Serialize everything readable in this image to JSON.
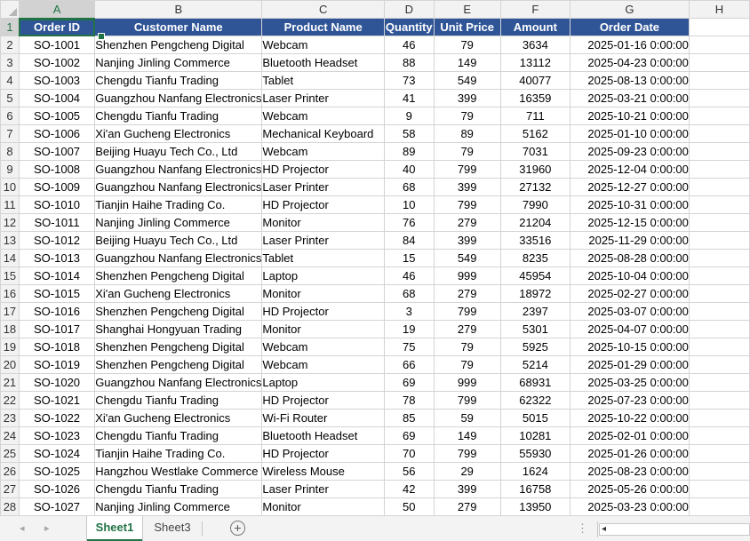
{
  "sheet": {
    "columns": [
      "A",
      "B",
      "C",
      "D",
      "E",
      "F",
      "G",
      "H"
    ],
    "active_column": "A",
    "active_row": "1",
    "headers": [
      "Order ID",
      "Customer Name",
      "Product Name",
      "Quantity",
      "Unit Price",
      "Amount",
      "Order Date"
    ],
    "rows": [
      [
        "SO-1001",
        "Shenzhen Pengcheng Digital",
        "Webcam",
        "46",
        "79",
        "3634",
        "2025-01-16 0:00:00"
      ],
      [
        "SO-1002",
        "Nanjing Jinling Commerce",
        "Bluetooth Headset",
        "88",
        "149",
        "13112",
        "2025-04-23 0:00:00"
      ],
      [
        "SO-1003",
        "Chengdu Tianfu Trading",
        "Tablet",
        "73",
        "549",
        "40077",
        "2025-08-13 0:00:00"
      ],
      [
        "SO-1004",
        "Guangzhou Nanfang Electronics",
        "Laser Printer",
        "41",
        "399",
        "16359",
        "2025-03-21 0:00:00"
      ],
      [
        "SO-1005",
        "Chengdu Tianfu Trading",
        "Webcam",
        "9",
        "79",
        "711",
        "2025-10-21 0:00:00"
      ],
      [
        "SO-1006",
        "Xi'an Gucheng Electronics",
        "Mechanical Keyboard",
        "58",
        "89",
        "5162",
        "2025-01-10 0:00:00"
      ],
      [
        "SO-1007",
        "Beijing Huayu Tech Co., Ltd",
        "Webcam",
        "89",
        "79",
        "7031",
        "2025-09-23 0:00:00"
      ],
      [
        "SO-1008",
        "Guangzhou Nanfang Electronics",
        "HD Projector",
        "40",
        "799",
        "31960",
        "2025-12-04 0:00:00"
      ],
      [
        "SO-1009",
        "Guangzhou Nanfang Electronics",
        "Laser Printer",
        "68",
        "399",
        "27132",
        "2025-12-27 0:00:00"
      ],
      [
        "SO-1010",
        "Tianjin Haihe Trading Co.",
        "HD Projector",
        "10",
        "799",
        "7990",
        "2025-10-31 0:00:00"
      ],
      [
        "SO-1011",
        "Nanjing Jinling Commerce",
        "Monitor",
        "76",
        "279",
        "21204",
        "2025-12-15 0:00:00"
      ],
      [
        "SO-1012",
        "Beijing Huayu Tech Co., Ltd",
        "Laser Printer",
        "84",
        "399",
        "33516",
        "2025-11-29 0:00:00"
      ],
      [
        "SO-1013",
        "Guangzhou Nanfang Electronics",
        "Tablet",
        "15",
        "549",
        "8235",
        "2025-08-28 0:00:00"
      ],
      [
        "SO-1014",
        "Shenzhen Pengcheng Digital",
        "Laptop",
        "46",
        "999",
        "45954",
        "2025-10-04 0:00:00"
      ],
      [
        "SO-1015",
        "Xi'an Gucheng Electronics",
        "Monitor",
        "68",
        "279",
        "18972",
        "2025-02-27 0:00:00"
      ],
      [
        "SO-1016",
        "Shenzhen Pengcheng Digital",
        "HD Projector",
        "3",
        "799",
        "2397",
        "2025-03-07 0:00:00"
      ],
      [
        "SO-1017",
        "Shanghai Hongyuan Trading",
        "Monitor",
        "19",
        "279",
        "5301",
        "2025-04-07 0:00:00"
      ],
      [
        "SO-1018",
        "Shenzhen Pengcheng Digital",
        "Webcam",
        "75",
        "79",
        "5925",
        "2025-10-15 0:00:00"
      ],
      [
        "SO-1019",
        "Shenzhen Pengcheng Digital",
        "Webcam",
        "66",
        "79",
        "5214",
        "2025-01-29 0:00:00"
      ],
      [
        "SO-1020",
        "Guangzhou Nanfang Electronics",
        "Laptop",
        "69",
        "999",
        "68931",
        "2025-03-25 0:00:00"
      ],
      [
        "SO-1021",
        "Chengdu Tianfu Trading",
        "HD Projector",
        "78",
        "799",
        "62322",
        "2025-07-23 0:00:00"
      ],
      [
        "SO-1022",
        "Xi'an Gucheng Electronics",
        "Wi-Fi Router",
        "85",
        "59",
        "5015",
        "2025-10-22 0:00:00"
      ],
      [
        "SO-1023",
        "Chengdu Tianfu Trading",
        "Bluetooth Headset",
        "69",
        "149",
        "10281",
        "2025-02-01 0:00:00"
      ],
      [
        "SO-1024",
        "Tianjin Haihe Trading Co.",
        "HD Projector",
        "70",
        "799",
        "55930",
        "2025-01-26 0:00:00"
      ],
      [
        "SO-1025",
        "Hangzhou Westlake Commerce",
        "Wireless Mouse",
        "56",
        "29",
        "1624",
        "2025-08-23 0:00:00"
      ],
      [
        "SO-1026",
        "Chengdu Tianfu Trading",
        "Laser Printer",
        "42",
        "399",
        "16758",
        "2025-05-26 0:00:00"
      ],
      [
        "SO-1027",
        "Nanjing Jinling Commerce",
        "Monitor",
        "50",
        "279",
        "13950",
        "2025-03-23 0:00:00"
      ]
    ]
  },
  "tabs": [
    {
      "label": "Sheet1",
      "active": true
    },
    {
      "label": "Sheet3",
      "active": false
    }
  ],
  "tabbar": {
    "prev_icon": "◂",
    "next_icon": "▸",
    "add_icon": "+",
    "dots": "⋮",
    "scroll_left_icon": "◂"
  },
  "colors": {
    "header_fill": "#2f5597",
    "accent": "#217346"
  }
}
